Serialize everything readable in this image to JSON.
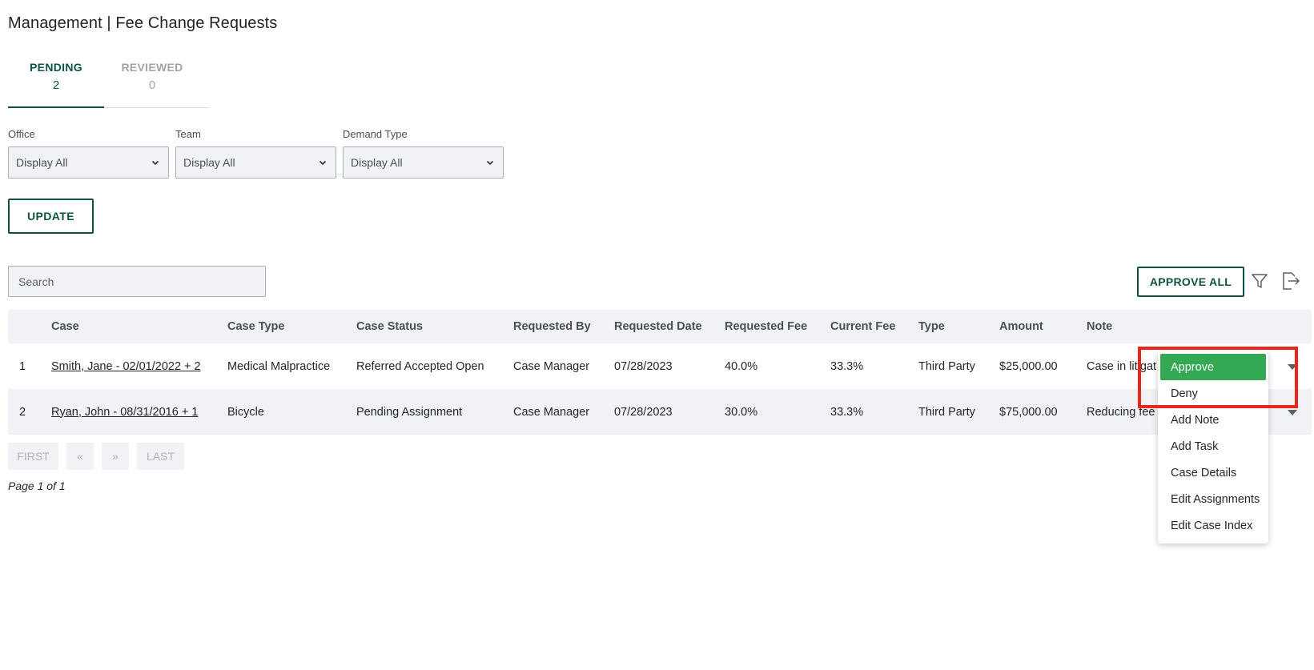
{
  "page": {
    "title": "Management | Fee Change Requests"
  },
  "tabs": [
    {
      "label": "PENDING",
      "count": "2"
    },
    {
      "label": "REVIEWED",
      "count": "0"
    }
  ],
  "filters": [
    {
      "label": "Office",
      "value": "Display All"
    },
    {
      "label": "Team",
      "value": "Display All"
    },
    {
      "label": "Demand Type",
      "value": "Display All"
    }
  ],
  "actions": {
    "update_label": "UPDATE",
    "approve_all_label": "APPROVE ALL",
    "filter_icon": "filter-icon",
    "export_icon": "export-icon"
  },
  "search": {
    "placeholder": "Search",
    "value": ""
  },
  "table": {
    "headers": [
      "",
      "Case",
      "Case Type",
      "Case Status",
      "Requested By",
      "Requested Date",
      "Requested Fee",
      "Current Fee",
      "Type",
      "Amount",
      "Note"
    ],
    "rows": [
      {
        "num": "1",
        "case": "Smith, Jane - 02/01/2022 + 2",
        "case_type": "Medical Malpractice",
        "case_status": "Referred Accepted Open",
        "requested_by": "Case Manager",
        "requested_date": "07/28/2023",
        "requested_fee": "40.0%",
        "current_fee": "33.3%",
        "type": "Third Party",
        "amount": "$25,000.00",
        "note": "Case in litigat"
      },
      {
        "num": "2",
        "case": "Ryan, John - 08/31/2016 + 1",
        "case_type": "Bicycle",
        "case_status": "Pending Assignment",
        "requested_by": "Case Manager",
        "requested_date": "07/28/2023",
        "requested_fee": "30.0%",
        "current_fee": "33.3%",
        "type": "Third Party",
        "amount": "$75,000.00",
        "note": "Reducing fee"
      }
    ]
  },
  "pagination": {
    "first": "FIRST",
    "prev": "«",
    "next": "»",
    "last": "LAST",
    "info": "Page 1 of 1"
  },
  "row_menu": {
    "selected": "Approve",
    "items": [
      "Approve",
      "Deny",
      "Add Note",
      "Add Task",
      "Case Details",
      "Edit Assignments",
      "Edit Case Index"
    ]
  },
  "colors": {
    "brand": "#0d5247",
    "approve_green": "#34a853",
    "highlight_red": "#e8261c",
    "row_alt": "#f0f2f5"
  }
}
